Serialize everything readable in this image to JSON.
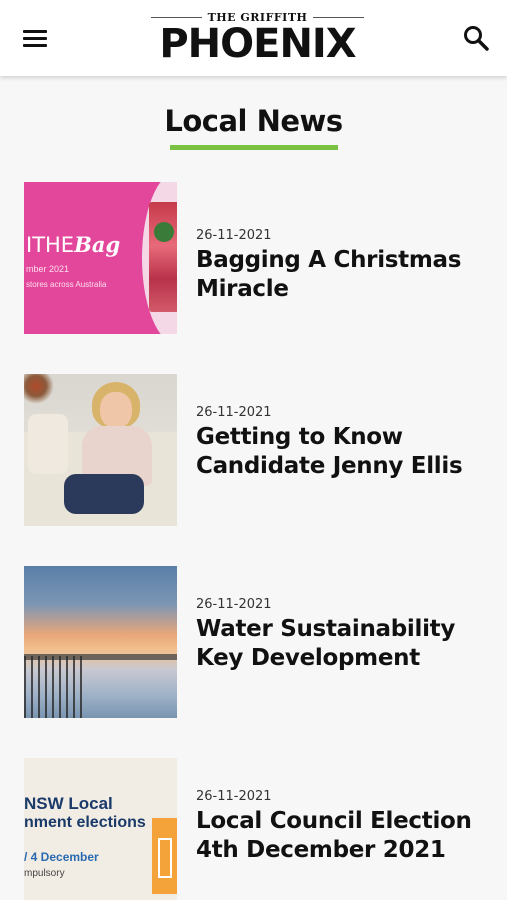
{
  "header": {
    "logo_top": "THE GRIFFITH",
    "logo_main": "PHOENIX",
    "menu_icon": "hamburger-menu-icon",
    "search_icon": "search-icon"
  },
  "section": {
    "title": "Local News",
    "accent_color": "#7cc242"
  },
  "articles": [
    {
      "date": "26-11-2021",
      "headline": "Bagging A Christmas Miracle",
      "thumb_text": {
        "big": "ITHE",
        "brand": "Bag",
        "line1": "mber 2021",
        "line2": "stores across Australia"
      }
    },
    {
      "date": "26-11-2021",
      "headline": "Getting to Know Candidate Jenny Ellis"
    },
    {
      "date": "26-11-2021",
      "headline": "Water Sustainability Key Development"
    },
    {
      "date": "26-11-2021",
      "headline": "Local Council Election 4th December 2021",
      "thumb_text": {
        "line1": "NSW Local",
        "line2": "nment elections",
        "line3": "/ 4 December",
        "line4": "mpulsory"
      }
    }
  ]
}
